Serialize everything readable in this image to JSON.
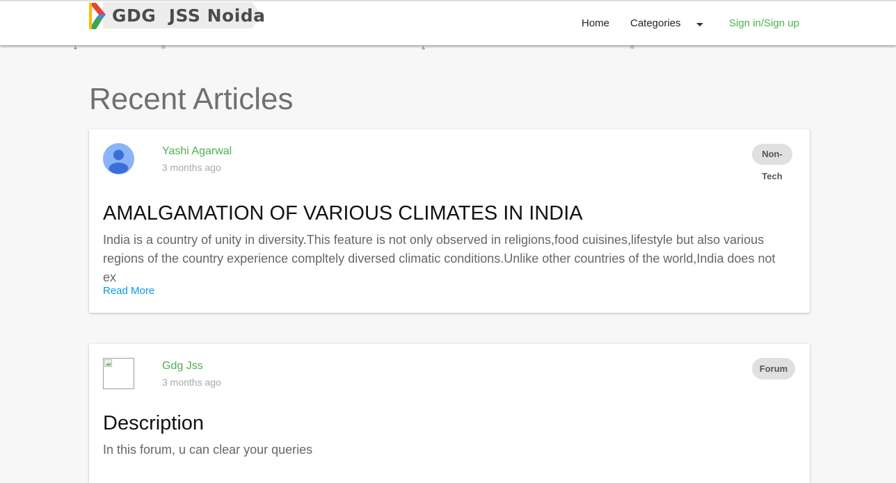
{
  "header": {
    "logo_text": "GDG  JSS Noida",
    "nav": {
      "home": "Home",
      "categories": "Categories",
      "sign_in": "Sign in/Sign up"
    }
  },
  "page_title": "Recent Articles",
  "articles": [
    {
      "author": "Yashi Agarwal",
      "time": "3 months ago",
      "category_line1": "Non-",
      "category_line2": "Tech",
      "title": "AMALGAMATION OF VARIOUS CLIMATES IN INDIA",
      "excerpt": "India is a country of unity in diversity.This feature is not only observed in religions,food cuisines,lifestyle but also various regions of the country experience compltely diversed climatic conditions.Unlike other countries of the world,India does not ex",
      "read_more": "Read More"
    },
    {
      "author": "Gdg Jss",
      "time": "3 months ago",
      "category": "Forum",
      "title": "Description",
      "excerpt": "In this forum, u can clear your queries"
    }
  ],
  "colors": {
    "accent_green": "#4caf50",
    "link_blue": "#039be5",
    "avatar_blue": "#8ab4f8"
  }
}
